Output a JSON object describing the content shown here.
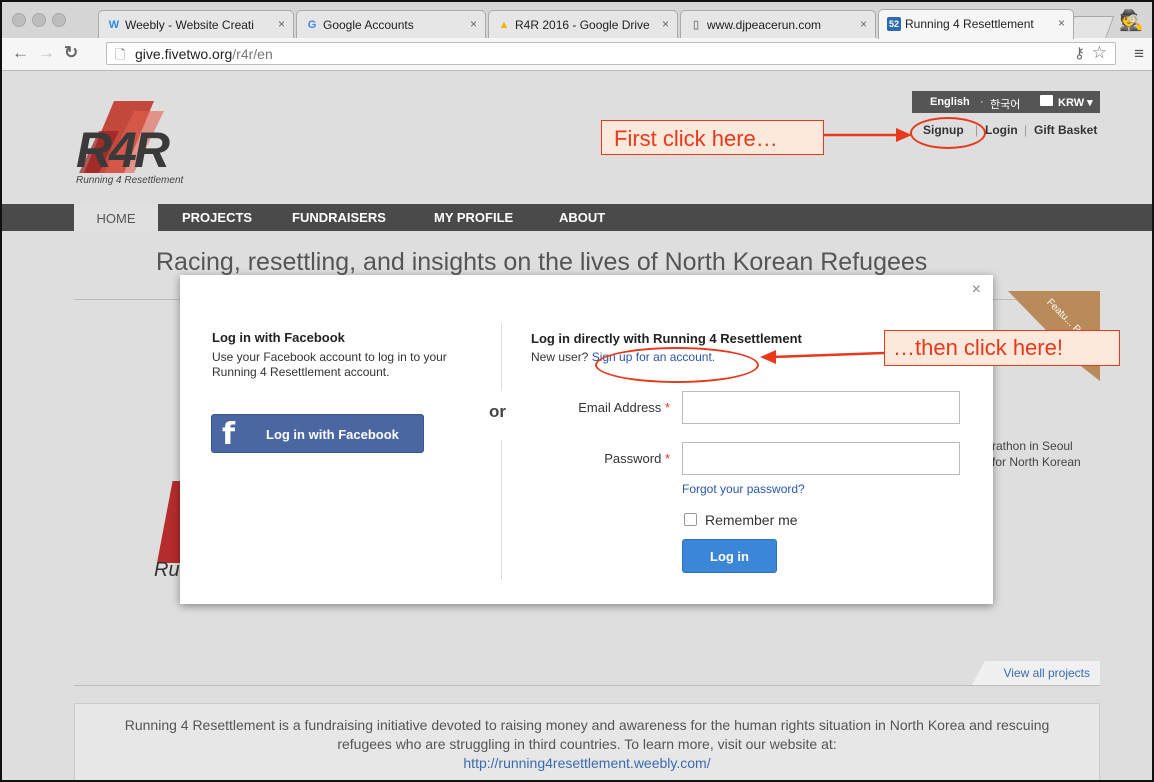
{
  "browser": {
    "tabs": [
      {
        "icon": "W",
        "title": "Weebly - Website Creati"
      },
      {
        "icon": "G",
        "title": "Google Accounts"
      },
      {
        "icon": "▲",
        "title": "R4R 2016 - Google Drive"
      },
      {
        "icon": "▯",
        "title": "www.djpeacerun.com"
      },
      {
        "icon": "52",
        "title": "Running 4 Resettlement"
      }
    ],
    "tab_close": "×",
    "url_domain": "give.fivetwo.org",
    "url_path": "/r4r/en"
  },
  "header": {
    "logo": "R4R",
    "logo_sub": "Running 4 Resettlement",
    "lang_en": "English",
    "lang_sep": "·",
    "lang_ko": "한국어",
    "currency": "KRW ▾",
    "signup": "Signup",
    "login": "Login",
    "gift": "Gift Basket",
    "link_sep": "|"
  },
  "annotations": {
    "first": "First click here…",
    "then": "…then click here!"
  },
  "nav": {
    "home": "HOME",
    "projects": "PROJECTS",
    "fundraisers": "FUNDRAISERS",
    "profile": "MY PROFILE",
    "about": "ABOUT"
  },
  "main": {
    "headline": "Racing, resettling, and insights on the lives of North Korean Refugees",
    "ribbon": "Featu... Pr...",
    "project_text_1": "rathon in Seoul",
    "project_text_2": "for North Korean",
    "ru": "Ru",
    "view_all": "View all projects",
    "intro": "Running 4 Resettlement is a fundraising initiative devoted to raising money and awareness for the human rights situation in North Korea and rescuing refugees who are struggling in third countries. To learn more, visit our website at:",
    "intro_link": "http://running4resettlement.weebly.com/"
  },
  "modal": {
    "close": "×",
    "fb_title": "Log in with Facebook",
    "fb_desc": "Use your Facebook account to log in to your Running 4 Resettlement account.",
    "fb_button": "Log in with Facebook",
    "or": "or",
    "direct_title": "Log in directly with Running 4 Resettlement",
    "new_user": "New user?",
    "signup_link": "Sign up for an account.",
    "email_label": "Email Address",
    "password_label": "Password",
    "required": "*",
    "forgot": "Forgot your password?",
    "remember": "Remember me",
    "login_button": "Log in"
  }
}
